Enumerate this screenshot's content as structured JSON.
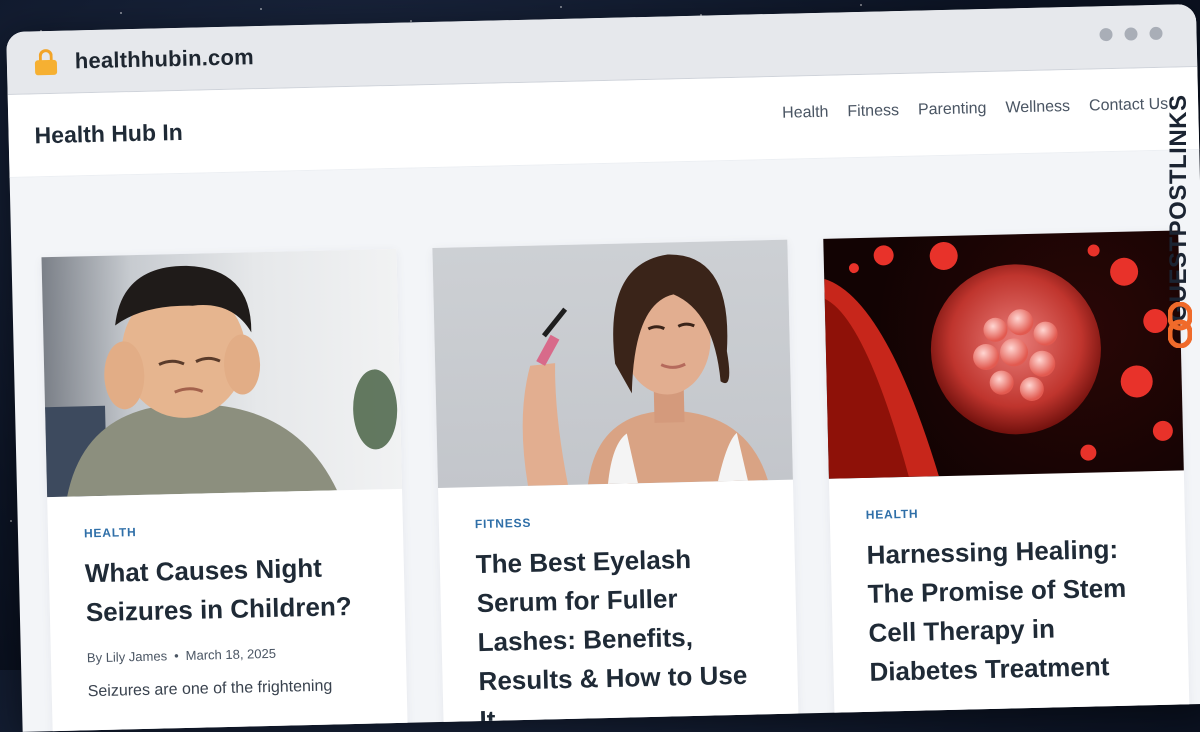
{
  "browser": {
    "url": "healthhubin.com"
  },
  "site": {
    "brand": "Health Hub In",
    "nav": [
      "Health",
      "Fitness",
      "Parenting",
      "Wellness",
      "Contact Us"
    ]
  },
  "posts": [
    {
      "category": "HEALTH",
      "title": "What Causes Night Seizures in Children?",
      "author": "By Lily James",
      "date": "March 18, 2025",
      "excerpt": "Seizures are one of the frightening"
    },
    {
      "category": "FITNESS",
      "title": "The Best Eyelash Serum for Fuller Lashes: Benefits, Results & How to Use It"
    },
    {
      "category": "HEALTH",
      "title": "Harnessing Healing: The Promise of Stem Cell Therapy in Diabetes Treatment"
    }
  ],
  "watermark": {
    "text": "GUESTPOSTLINKS"
  },
  "colors": {
    "accent": "#2f6fa8",
    "watermark_logo": "#f06a2a",
    "lock": "#f6b032"
  }
}
